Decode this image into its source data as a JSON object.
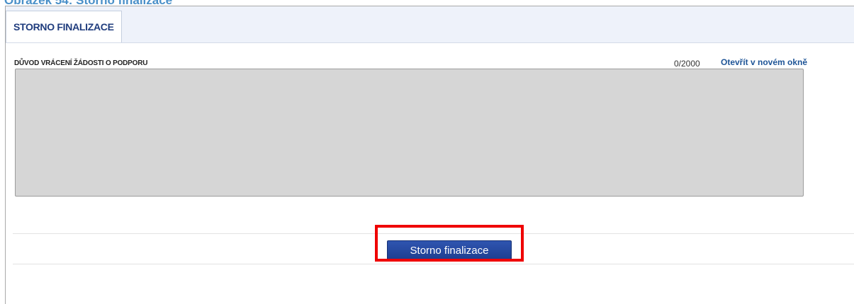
{
  "caption": "Obrázek 54: Storno finalizace",
  "tabs": [
    {
      "label": "STORNO FINALIZACE",
      "active": true
    }
  ],
  "field": {
    "label": "DŮVOD VRÁCENÍ ŽÁDOSTI O PODPORU",
    "counter": "0/2000",
    "open_link": "Otevřít v novém okně",
    "value": ""
  },
  "actions": {
    "storno_label": "Storno finalizace"
  },
  "colors": {
    "caption": "#4a90c8",
    "tab_text": "#1f3c7d",
    "link": "#1f5597",
    "textarea_bg": "#d6d6d6",
    "button_bg": "#2648a0",
    "highlight": "#ef0000"
  }
}
